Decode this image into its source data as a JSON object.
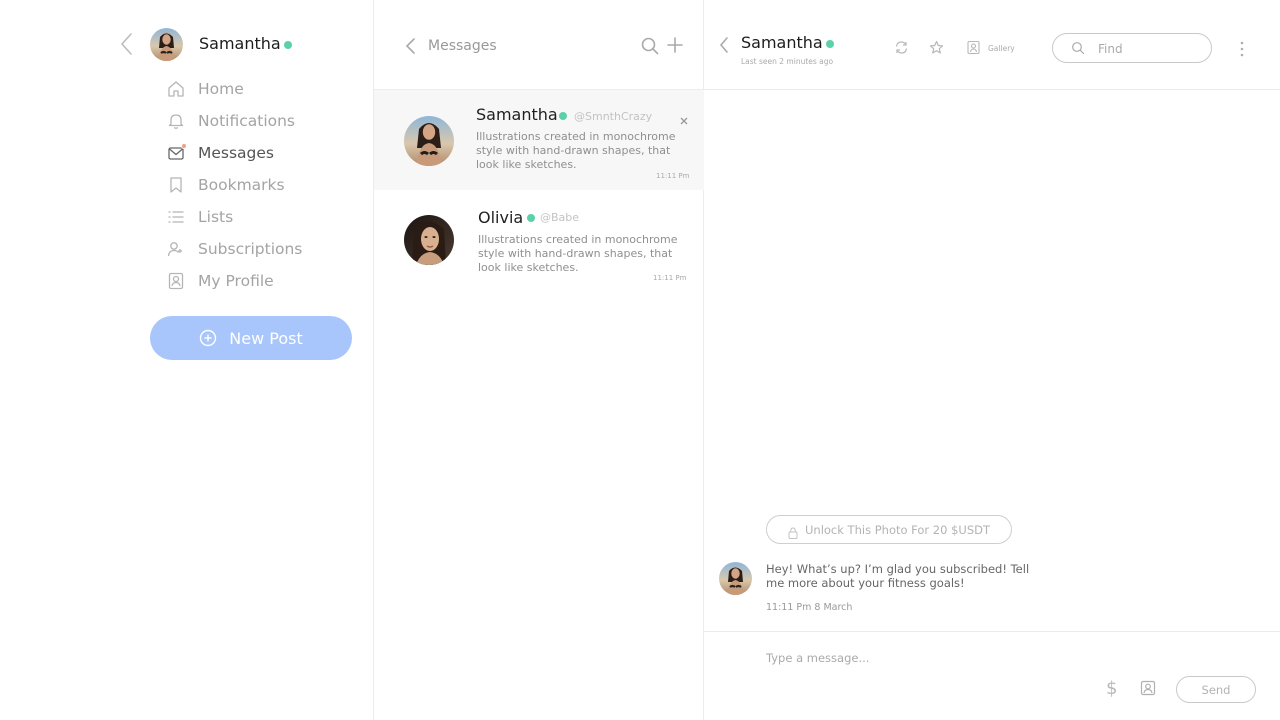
{
  "sidebar": {
    "profile_name": "Samantha",
    "nav": [
      {
        "label": "Home",
        "icon": "home-icon"
      },
      {
        "label": "Notifications",
        "icon": "bell-icon"
      },
      {
        "label": "Messages",
        "icon": "envelope-icon",
        "active": true,
        "badge": true
      },
      {
        "label": "Bookmarks",
        "icon": "bookmark-icon"
      },
      {
        "label": "Lists",
        "icon": "list-icon"
      },
      {
        "label": "Subscriptions",
        "icon": "user-plus-icon"
      },
      {
        "label": "My Profile",
        "icon": "profile-icon"
      }
    ],
    "new_post_label": "New Post"
  },
  "messages_panel": {
    "title": "Messages",
    "conversations": [
      {
        "name": "Samantha",
        "handle": "@SmnthCrazy",
        "preview": "Illustrations created in monochrome style with hand-drawn shapes, that look like sketches.",
        "time": "11:11 Pm"
      },
      {
        "name": "Olivia",
        "handle": "@Babe",
        "preview": "Illustrations created in monochrome style with hand-drawn shapes, that look like sketches.",
        "time": "11:11 Pm"
      }
    ]
  },
  "chat": {
    "name": "Samantha",
    "last_seen": "Last seen 2 minutes ago",
    "gallery_label": "Gallery",
    "find_placeholder": "Find",
    "unlock_label": "Unlock This Photo For 20 $USDT",
    "message_text": "Hey! What’s up? I’m glad you subscribed! Tell me more about your fitness goals!",
    "message_time": "11:11 Pm 8 March",
    "composer_placeholder": "Type a message...",
    "dollar_symbol": "$",
    "send_label": "Send"
  },
  "colors": {
    "accent": "#a8c6fb",
    "online": "#5bd1a7",
    "badge": "#f0a080"
  }
}
